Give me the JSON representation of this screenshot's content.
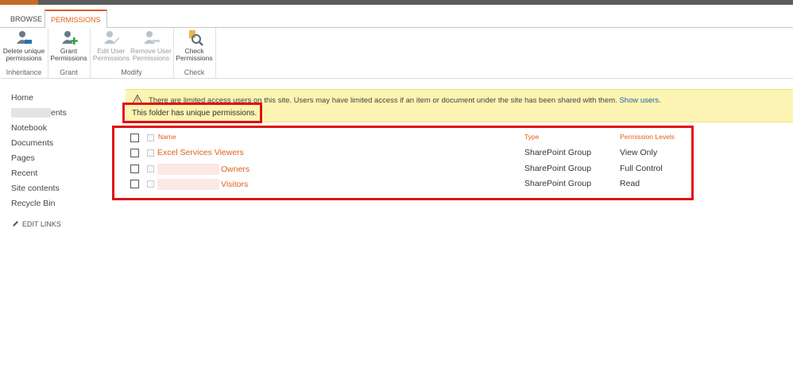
{
  "tabs": {
    "browse": "BROWSE",
    "permissions": "PERMISSIONS"
  },
  "ribbon": {
    "groups": [
      {
        "label": "Inheritance",
        "buttons": [
          {
            "line1": "Delete unique",
            "line2": "permissions"
          }
        ]
      },
      {
        "label": "Grant",
        "buttons": [
          {
            "line1": "Grant",
            "line2": "Permissions"
          }
        ]
      },
      {
        "label": "Modify",
        "buttons": [
          {
            "line1": "Edit User",
            "line2": "Permissions"
          },
          {
            "line1": "Remove User",
            "line2": "Permissions"
          }
        ]
      },
      {
        "label": "Check",
        "buttons": [
          {
            "line1": "Check",
            "line2": "Permissions"
          }
        ]
      }
    ]
  },
  "nav": {
    "items": [
      "Home",
      "ents",
      "Notebook",
      "Documents",
      "Pages",
      "Recent",
      "Site contents",
      "Recycle Bin"
    ],
    "edit_links": "EDIT LINKS"
  },
  "notice": {
    "limited_text": "There are limited access users on this site. Users may have limited access if an item or document under the site has been shared with them.",
    "show_users": "Show users.",
    "unique_text": "This folder has unique permissions."
  },
  "table": {
    "headers": {
      "name": "Name",
      "type": "Type",
      "levels": "Permission Levels"
    },
    "rows": [
      {
        "name": "Excel Services Viewers",
        "type": "SharePoint Group",
        "level": "View Only"
      },
      {
        "name": "Owners",
        "type": "SharePoint Group",
        "level": "Full Control"
      },
      {
        "name": "Visitors",
        "type": "SharePoint Group",
        "level": "Read"
      }
    ]
  },
  "colors": {
    "accent": "#e0601b",
    "notice_bg": "#fcf4b2",
    "highlight": "#e01010",
    "link": "#1f64a8"
  }
}
